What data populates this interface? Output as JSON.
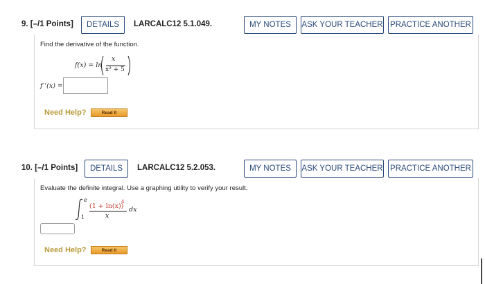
{
  "questions": [
    {
      "number": "9.",
      "points": "[–/1 Points]",
      "details_label": "DETAILS",
      "code": "LARCALC12 5.1.049.",
      "my_notes_label": "MY NOTES",
      "ask_teacher_label": "ASK YOUR TEACHER",
      "practice_label": "PRACTICE ANOTHER",
      "prompt": "Find the derivative of the function.",
      "function_lhs": "f(x) = ln",
      "numerator": "x",
      "denominator": "x² + 5",
      "answer_label": "f '(x) =",
      "answer_value": "",
      "need_help": "Need Help?",
      "read_it": "Read It"
    },
    {
      "number": "10.",
      "points": "[–/1 Points]",
      "details_label": "DETAILS",
      "code": "LARCALC12 5.2.053.",
      "my_notes_label": "MY NOTES",
      "ask_teacher_label": "ASK YOUR TEACHER",
      "practice_label": "PRACTICE ANOTHER",
      "prompt": "Evaluate the definite integral. Use a graphing utility to verify your result.",
      "upper_limit": "e",
      "lower_limit": "1",
      "numerator": "(1 + ln(x))",
      "exponent": "4",
      "denominator": "x",
      "differential": "dx",
      "answer_value": "",
      "need_help": "Need Help?",
      "read_it": "Read It"
    }
  ],
  "colors": {
    "button_border": "#2a4a7a",
    "need_help": "#b89a3a",
    "exponent_red": "#d03030",
    "read_it_bg": "#e89b2a"
  }
}
